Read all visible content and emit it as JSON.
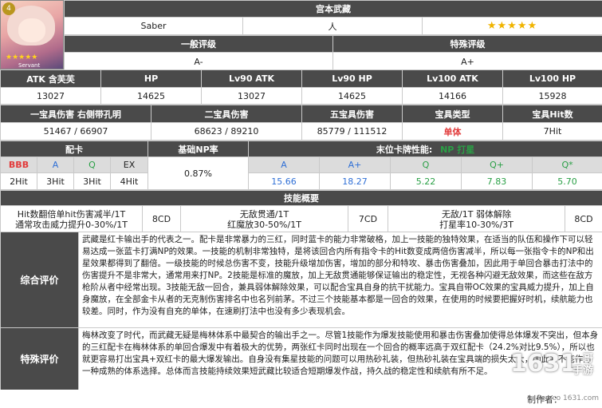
{
  "servant": {
    "name": "宫本武藏",
    "class": "Saber",
    "attribute": "人",
    "stars": "★★★★★",
    "portrait_stars": "★★★★★",
    "portrait_label": "Servant",
    "class_badge": "4"
  },
  "ratings": {
    "general_label": "一般评级",
    "general_value": "A-",
    "special_label": "特殊评级",
    "special_value": "A+"
  },
  "stats": {
    "headers": [
      "ATK 含芙芙",
      "HP",
      "Lv90 ATK",
      "Lv90 HP",
      "Lv100 ATK",
      "Lv100 HP"
    ],
    "values": [
      "13027",
      "14625",
      "13027",
      "14625",
      "14166",
      "15928"
    ]
  },
  "np": {
    "headers": [
      "一宝具伤害 右侧带孔明",
      "二宝具伤害",
      "五宝具伤害",
      "宝具类型",
      "宝具Hit数"
    ],
    "values": [
      "51467 / 66907",
      "68623 / 89210",
      "85779 / 111512",
      "单体",
      "7Hit"
    ]
  },
  "cards": {
    "card_label": "配卡",
    "np_rate_label": "基础NP率",
    "last_card_label": "末位卡牌性能:",
    "last_card_extra": "NP 打星",
    "types": [
      "BBB",
      "A",
      "Q",
      "EX"
    ],
    "hits": [
      "2Hit",
      "3Hit",
      "3Hit",
      "4Hit"
    ],
    "np_rate": "0.87%",
    "perf_headers": [
      "A",
      "A+",
      "Q",
      "Q+",
      "Q*"
    ],
    "perf_values": [
      "15.66",
      "18.27",
      "5.22",
      "7.83",
      "5.70"
    ]
  },
  "skills": {
    "title": "技能概要",
    "s1": [
      "Hit数翻倍单hit伤害减半/1T",
      "通常攻击威力提升0-30%/1T"
    ],
    "s1_cd": "8CD",
    "s2": [
      "无敌贯通/1T",
      "红魔放30-50%/1T"
    ],
    "s2_cd": "7CD",
    "s3": [
      "无敌/1T 弱体解除",
      "打星率10-30%/3T"
    ],
    "s3_cd": "8CD"
  },
  "evaluation": {
    "general_label": "综合评价",
    "general_text": "武藏是红卡输出手的代表之一。配卡是非常暴力的三红，同时蓝卡的能力非常破格，加上一技能的独特效果，在适当的队伍和操作下可以轻易达成一张蓝卡打满NP的效果。一技能的机制非常独特，是将该回合内所有指令卡的Hit数变成两倍伤害减半，所以每一张指令卡的NP和出星效果都得到了翻倍。一级技能的时候总伤害不变，技能升级增加伤害，增加的部分和特攻、暴击伤害叠加，因此用于单回合暴击打法中的伤害提升不是非常大，通常用来打NP。2技能是标准的魔放，加上无敌贯通能够保证输出的稳定性，无视各种闪避无敌效果，而这些在敌方枪阶从者中经常出现。3技能无敌一回合，兼具弱体解除效果，可以配合宝具自身的抗干扰能力。宝具自带OC效果的宝具威力提升，加上自身魔放，在全部金卡从者的无克制伤害排名中也名列前茅。不过三个技能基本都是一回合的效果，在使用的时候要把握好时机，续航能力也较差。同时，作为没有自充的单体，在速刷打法中也没有多少表现机会。",
    "special_label": "特殊评价",
    "special_text": "梅林改变了时代，而武藏无疑是梅林体系中最契合的输出手之一。尽管1技能作为爆发技能使用和暴击伤害叠加使得总体爆发不突出，但本身的三红配卡在梅林体系的单回合爆发中有着极大的优势，两张红卡同时出现在一个回合的概率远高于双红配卡（24.2%对比9.5%），所以也就更容易打出宝具+双红卡的最大爆发输出。自身没有集星技能的问题可以用热砂礼装，但热砂礼装在宝具端的损失太大，因此并不能作为一种成熟的体系选择。总体而言技能持续效果短武藏比较适合短期爆发作战，持久战的稳定性和续航有所不足。"
  },
  "footer": {
    "author": "制作者：",
    "site": "Sen.co 1631.com"
  },
  "logo": {
    "number": "1631",
    "text1": "一哥",
    "text2": "手游"
  }
}
